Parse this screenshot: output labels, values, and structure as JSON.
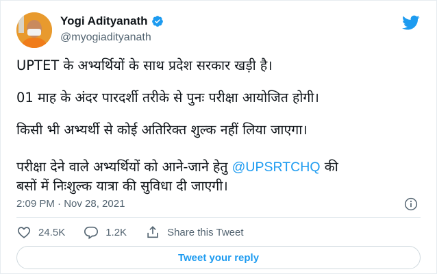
{
  "tweet": {
    "author_name": "Yogi Adityanath",
    "author_handle": "@myogiadityanath",
    "paragraphs": [
      "UPTET के अभ्यर्थियों के साथ प्रदेश सरकार खड़ी है।",
      "01 माह के अंदर पारदर्शी तरीके से पुनः परीक्षा आयोजित होगी।",
      "किसी भी अभ्यर्थी से कोई अतिरिक्त शुल्क नहीं लिया जाएगा।"
    ],
    "para4_prefix": "परीक्षा देने वाले अभ्यर्थियों को आने-जाने हेतु ",
    "para4_mention": "@UPSRTCHQ",
    "para4_suffix": " की",
    "para4_line2": "बसों में निःशुल्क यात्रा की सुविधा दी जाएगी।",
    "timestamp": "2:09 PM · Nov 28, 2021"
  },
  "actions": {
    "likes": "24.5K",
    "replies": "1.2K",
    "share_label": "Share this Tweet"
  },
  "reply_button_label": "Tweet your reply",
  "icons": {
    "verified": "verified-badge-icon",
    "brand": "twitter-bird-icon",
    "info": "info-icon",
    "like": "heart-icon",
    "reply": "speech-bubble-icon",
    "share": "share-icon"
  },
  "colors": {
    "accent": "#1d9bf0",
    "text": "#0f1419",
    "secondary_text": "#536471"
  }
}
